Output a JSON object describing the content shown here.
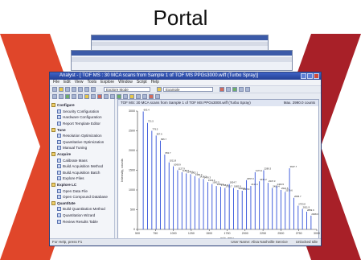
{
  "slide": {
    "title": "Portal"
  },
  "colors": {
    "chevron_left": "#e0462a",
    "chevron_right": "#a82028",
    "spectrum": "#2f4fd8",
    "titlebar": "#2b47a3"
  },
  "main_window": {
    "title": "Analyst - [ TOF MS : 30 MCA scans from Sample 1 of TOF MS PPGs3000.wiff (Turbo Spray)]",
    "menu": [
      "File",
      "Edit",
      "View",
      "Tools",
      "Explore",
      "Window",
      "Script",
      "Help"
    ],
    "toolbar": {
      "mode_select": "Explore Mode",
      "project_select": "Example"
    },
    "sidebar": [
      {
        "label": "Configure",
        "type": "section",
        "icon": "gear-icon"
      },
      {
        "label": "Security Configuration",
        "type": "child",
        "icon": "lock-icon"
      },
      {
        "label": "Hardware Configuration",
        "type": "child",
        "icon": "hardware-icon"
      },
      {
        "label": "Report Template Editor",
        "type": "child",
        "icon": "report-icon"
      },
      {
        "label": "Tune",
        "type": "section",
        "icon": "tune-icon"
      },
      {
        "label": "Resolution Optimization",
        "type": "child",
        "icon": "wand-icon"
      },
      {
        "label": "Quantitative Optimization",
        "type": "child",
        "icon": "wand-icon"
      },
      {
        "label": "Manual Tuning",
        "type": "child",
        "icon": "hand-icon"
      },
      {
        "label": "Acquire",
        "type": "section",
        "icon": "acquire-icon"
      },
      {
        "label": "Calibrate Mass",
        "type": "child",
        "icon": "calibrate-icon"
      },
      {
        "label": "Build Acquisition Method",
        "type": "child",
        "icon": "method-icon"
      },
      {
        "label": "Build Acquisition Batch",
        "type": "child",
        "icon": "batch-icon"
      },
      {
        "label": "Explore Files",
        "type": "child",
        "icon": "folder-icon"
      },
      {
        "label": "Explore LC",
        "type": "section",
        "icon": "explore-icon"
      },
      {
        "label": "Open Data File",
        "type": "child",
        "icon": "open-icon"
      },
      {
        "label": "Open Compound Database",
        "type": "child",
        "icon": "database-icon"
      },
      {
        "label": "Quantitate",
        "type": "section",
        "icon": "quantitate-icon"
      },
      {
        "label": "Build Quantitation Method",
        "type": "child",
        "icon": "method-icon"
      },
      {
        "label": "Quantitation Wizard",
        "type": "child",
        "icon": "wizard-icon"
      },
      {
        "label": "Review Results Table",
        "type": "child",
        "icon": "table-icon"
      }
    ],
    "document": {
      "title": "TOF MS: 30 MCA scans from Sample 1 of TOF MS PPGs3000.wiff (Turbo Spray)",
      "max_label": "Max. 2990.0 counts"
    },
    "statusbar": {
      "left": "For Help, press F1",
      "user": "User Name: Alisa Nashville Service",
      "mode": "Unlocked Idle"
    }
  },
  "chart_data": {
    "type": "bar",
    "title": "TOF MS: 30 MCA scans from Sample 1 of TOF MS PPGs3000.wiff (Turbo Spray)",
    "xlabel": "m/z, amu",
    "ylabel": "Intensity, counts",
    "xlim": [
      500,
      3000
    ],
    "ylim": [
      0,
      3000
    ],
    "x_ticks": [
      500,
      750,
      1000,
      1250,
      1500,
      1750,
      2000,
      2250,
      2500,
      2750,
      3000
    ],
    "y_ticks": [
      0,
      500,
      1000,
      1500,
      2000,
      2500,
      3000
    ],
    "x": [
      580,
      640,
      700,
      760,
      820,
      880,
      940,
      1000,
      1060,
      1120,
      1180,
      1240,
      1300,
      1360,
      1420,
      1480,
      1540,
      1600,
      1660,
      1720,
      1780,
      1840,
      1900,
      1960,
      2020,
      2080,
      2140,
      2200,
      2260,
      2320,
      2380,
      2440,
      2500,
      2560,
      2620,
      2680,
      2740,
      2800,
      2860,
      2920
    ],
    "values": [
      2990,
      2700,
      2500,
      2380,
      2250,
      1900,
      1700,
      1600,
      1500,
      1450,
      1420,
      1400,
      1350,
      1300,
      1280,
      1200,
      1150,
      1100,
      1080,
      1050,
      1150,
      1050,
      1000,
      980,
      1250,
      1100,
      1450,
      1220,
      1500,
      1180,
      1050,
      1100,
      1000,
      950,
      1550,
      800,
      600,
      520,
      450,
      350
    ],
    "peak_labels": [
      "663.4",
      "721.5",
      "779.5",
      "837.6",
      "895.7",
      "953.7",
      "1011.8",
      "1069.9",
      "1127.9",
      "1186.0",
      "1244.1",
      "1302.1",
      "1360.2",
      "1418.3",
      "1476.3",
      "1534.4",
      "1592.5",
      "1650.5",
      "1708.6",
      "1766.7",
      "1824.7",
      "1882.8",
      "1940.9",
      "1998.9",
      "2057.0",
      "2115.1",
      "2173.1",
      "2231.2",
      "2289.3",
      "2347.3",
      "2405.4",
      "2463.5",
      "2521.5",
      "2579.6",
      "2637.7",
      "2695.7",
      "2753.8",
      "2811.9",
      "2869.9",
      "2928.0"
    ]
  }
}
